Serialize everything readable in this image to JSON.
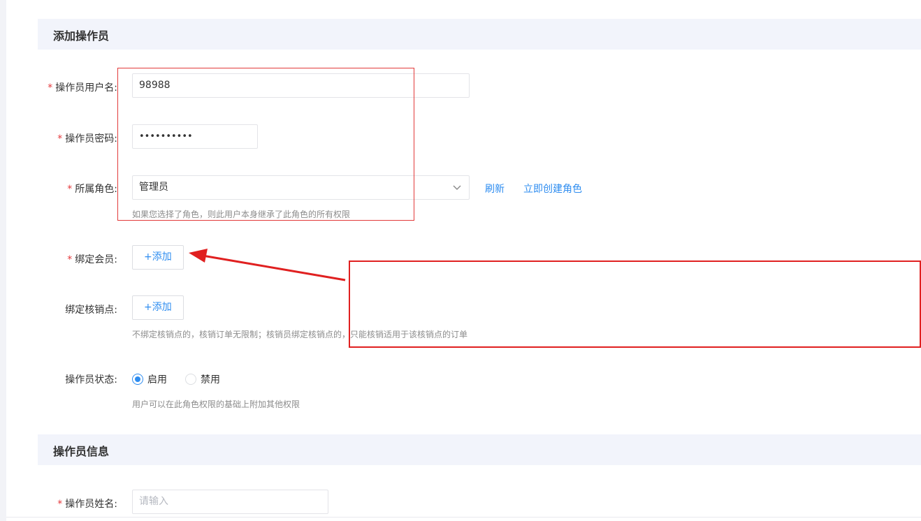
{
  "sections": {
    "add_operator": "添加操作员",
    "operator_info": "操作员信息"
  },
  "form": {
    "username": {
      "label": "操作员用户名:",
      "value": "98988",
      "required": true
    },
    "password": {
      "label": "操作员密码:",
      "value": "••••••••••",
      "required": true
    },
    "role": {
      "label": "所属角色:",
      "value": "管理员",
      "required": true,
      "refresh": "刷新",
      "create": "立即创建角色",
      "hint": "如果您选择了角色，则此用户本身继承了此角色的所有权限"
    },
    "bind_member": {
      "label": "绑定会员:",
      "button": "+添加",
      "required": true
    },
    "bind_point": {
      "label": "绑定核销点:",
      "button": "+添加",
      "hint": "不绑定核销点的，核销订单无限制；核销员绑定核销点的，只能核销适用于该核销点的订单"
    },
    "status": {
      "label": "操作员状态:",
      "options": [
        "启用",
        "禁用"
      ],
      "selected": "启用",
      "hint": "用户可以在此角色权限的基础上附加其他权限"
    },
    "name": {
      "label": "操作员姓名:",
      "placeholder": "请输入",
      "required": true
    }
  },
  "colors": {
    "accent": "#2d8cf0",
    "required": "#e4393c",
    "annotation": "#e02020"
  },
  "icons": {
    "select": "chevron-down-icon",
    "arrow": "annotation-arrow-icon"
  }
}
